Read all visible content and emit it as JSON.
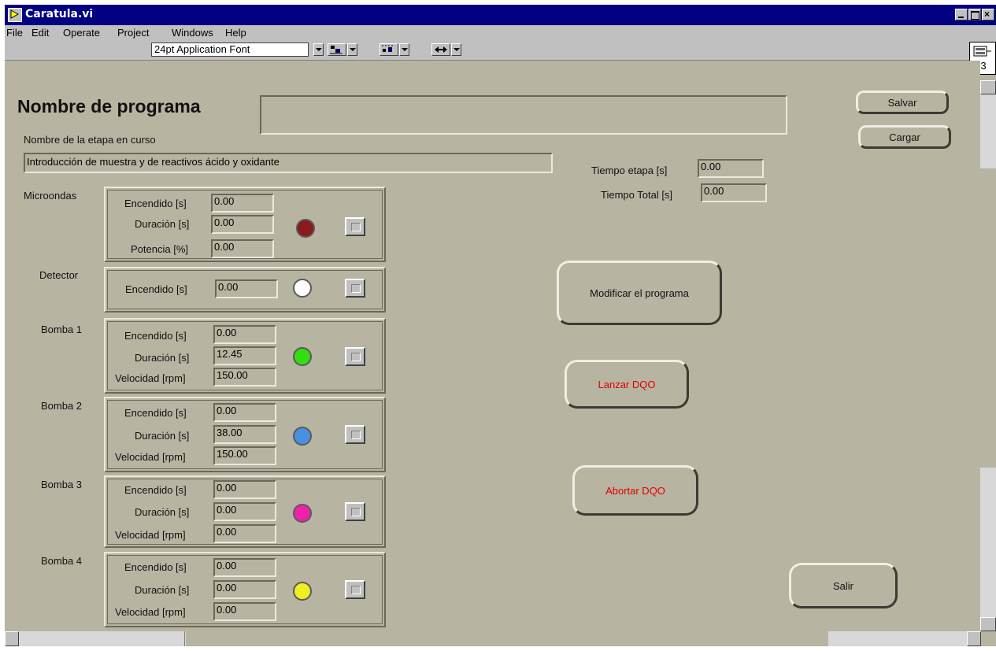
{
  "window": {
    "title": "Caratula.vi"
  },
  "menu": [
    "File",
    "Edit",
    "Operate",
    "Project",
    "Windows",
    "Help"
  ],
  "toolbar": {
    "font": "24pt Application Font",
    "vi_number": "3"
  },
  "program": {
    "title": "Nombre de programa",
    "name_value": "",
    "stage_label": "Nombre de la etapa en curso",
    "stage_value": "Introducción de muestra y de reactivos ácido y oxidante",
    "tiempo_etapa_label": "Tiempo etapa [s]",
    "tiempo_etapa": "0.00",
    "tiempo_total_label": "Tiempo Total [s]",
    "tiempo_total": "0.00"
  },
  "buttons": {
    "salvar": "Salvar",
    "cargar": "Cargar",
    "modificar": "Modificar el programa",
    "lanzar": "Lanzar DQO",
    "abortar": "Abortar DQO",
    "salir": "Salir"
  },
  "devices": {
    "microondas": {
      "name": "Microondas",
      "l1": "Encendido [s]",
      "v1": "0.00",
      "l2": "Duración [s]",
      "v2": "0.00",
      "l3": "Potencia [%]",
      "v3": "0.00",
      "led": "#8b1a1a"
    },
    "detector": {
      "name": "Detector",
      "l1": "Encendido [s]",
      "v1": "0.00",
      "led": "#ffffff"
    },
    "bomba1": {
      "name": "Bomba 1",
      "l1": "Encendido [s]",
      "v1": "0.00",
      "l2": "Duración [s]",
      "v2": "12.45",
      "l3": "Velocidad [rpm]",
      "v3": "150.00",
      "led": "#33dd11"
    },
    "bomba2": {
      "name": "Bomba 2",
      "l1": "Encendido [s]",
      "v1": "0.00",
      "l2": "Duración [s]",
      "v2": "38.00",
      "l3": "Velocidad [rpm]",
      "v3": "150.00",
      "led": "#4a90e2"
    },
    "bomba3": {
      "name": "Bomba 3",
      "l1": "Encendido [s]",
      "v1": "0.00",
      "l2": "Duración [s]",
      "v2": "0.00",
      "l3": "Velocidad [rpm]",
      "v3": "0.00",
      "led": "#ee22aa"
    },
    "bomba4": {
      "name": "Bomba 4",
      "l1": "Encendido [s]",
      "v1": "0.00",
      "l2": "Duración [s]",
      "v2": "0.00",
      "l3": "Velocidad [rpm]",
      "v3": "0.00",
      "led": "#eeee22"
    }
  }
}
